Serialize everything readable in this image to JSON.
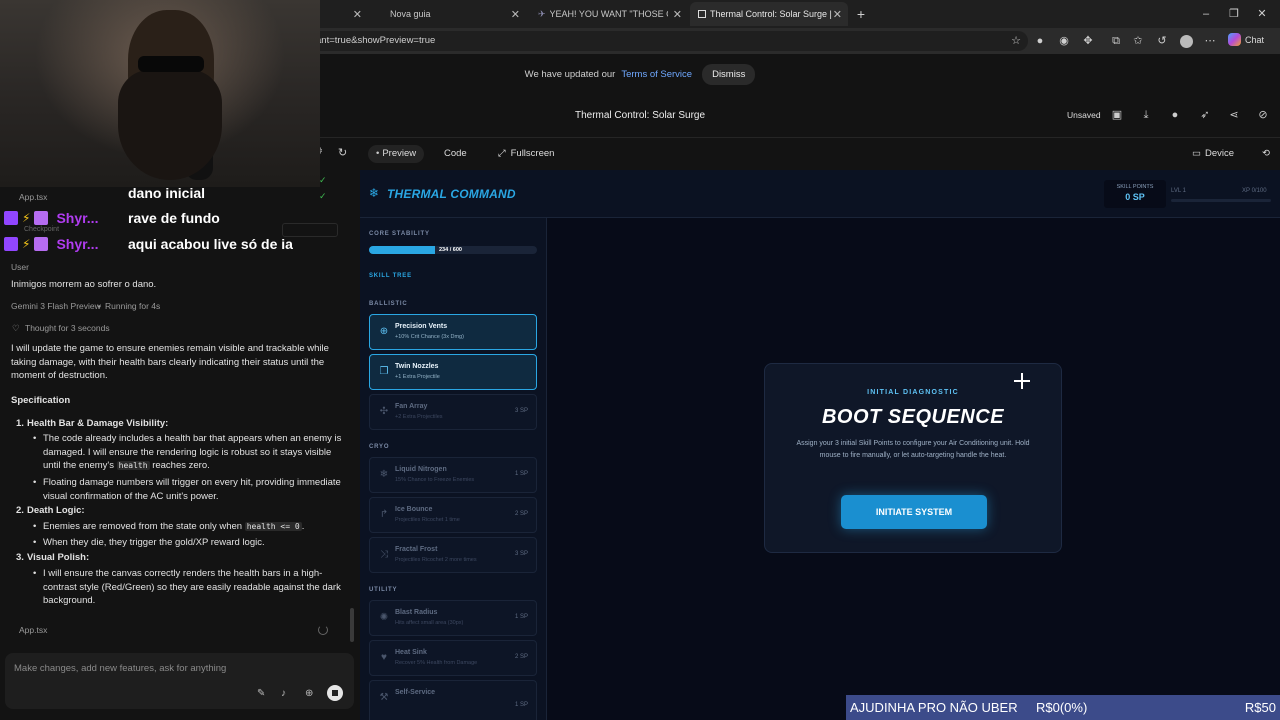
{
  "browser": {
    "tabs": [
      {
        "label": "Nova guia"
      },
      {
        "label": "YEAH! YOU WANT \"THOSE GAMES\"..."
      },
      {
        "label": "Thermal Control: Solar Surge | Go..."
      }
    ],
    "new_tab_label": "+",
    "url": "ant=true&showPreview=true",
    "chat_label": "Chat"
  },
  "notice": {
    "text": "We have updated our",
    "link": "Terms of Service",
    "dismiss": "Dismiss"
  },
  "app": {
    "title": "Thermal Control: Solar Surge",
    "unsaved": "Unsaved"
  },
  "stream_chat": [
    {
      "user": "",
      "msg": "dano inicial"
    },
    {
      "user": "Shyr...",
      "msg": "rave de fundo"
    },
    {
      "user": "Shyr...",
      "msg": "aqui acabou live só de ia"
    }
  ],
  "chat": {
    "file1": "App.tsx",
    "checkpoint": "Checkpoint",
    "user_label": "User",
    "user_msg": "Inimigos morrem ao sofrer o dano.",
    "model": "Gemini 3 Flash Preview",
    "running": "Running for 4s",
    "thought": "Thought for 3 seconds",
    "intro": "I will update the game to ensure enemies remain visible and trackable while taking damage, with their health bars clearly indicating their status until the moment of destruction.",
    "spec_heading": "Specification",
    "items": [
      {
        "num": "1.",
        "title": "Health Bar & Damage Visibility",
        "b1a": "The code already includes a health bar that appears when an enemy is damaged. I will ensure the rendering logic is robust so it stays visible until the enemy's",
        "b1code": "health",
        "b1b": "reaches zero.",
        "b2": "Floating damage numbers will trigger on every hit, providing immediate visual confirmation of the AC unit's power."
      },
      {
        "num": "2.",
        "title": "Death Logic",
        "b1a": "Enemies are removed from the state only when",
        "b1code": "health <= 0",
        "b1b": ".",
        "b2": "When they die, they trigger the gold/XP reward logic."
      },
      {
        "num": "3.",
        "title": "Visual Polish",
        "b1a": "I will ensure the canvas correctly renders the health bars in a high-contrast style (Red/Green) so they are easily readable against the dark background."
      }
    ],
    "file2": "App.tsx",
    "input_placeholder": "Make changes, add new features, ask for anything"
  },
  "preview_bar": {
    "preview": "Preview",
    "code": "Code",
    "fullscreen": "Fullscreen",
    "device": "Device"
  },
  "game": {
    "title": "THERMAL COMMAND",
    "skill_points_label": "SKILL POINTS",
    "skill_points_value": "0 SP",
    "level": "LVL 1",
    "xp": "XP 0/100",
    "core_stability_label": "CORE STABILITY",
    "core_stability_text": "234 / 600",
    "core_stability_fraction": 0.39,
    "skill_tree_label": "SKILL TREE",
    "sections": {
      "ballistic": "BALLISTIC",
      "cryo": "CRYO",
      "utility": "UTILITY"
    },
    "skills": [
      {
        "name": "Precision Vents",
        "desc": "+10% Crit Chance (3x Dmg)",
        "cost": "",
        "icon": "crosshair-icon"
      },
      {
        "name": "Twin Nozzles",
        "desc": "+1 Extra Projectile",
        "cost": "",
        "icon": "copy-icon"
      },
      {
        "name": "Fan Array",
        "desc": "+2 Extra Projectiles",
        "cost": "3 SP",
        "icon": "fan-icon"
      },
      {
        "name": "Liquid Nitrogen",
        "desc": "15% Chance to Freeze Enemies",
        "cost": "1 SP",
        "icon": "snowflake-icon"
      },
      {
        "name": "Ice Bounce",
        "desc": "Projectiles Ricochet 1 time",
        "cost": "2 SP",
        "icon": "bounce-icon"
      },
      {
        "name": "Fractal Frost",
        "desc": "Projectiles Ricochet 2 more times",
        "cost": "3 SP",
        "icon": "fractal-icon"
      },
      {
        "name": "Blast Radius",
        "desc": "Hits affect small area (30px)",
        "cost": "1 SP",
        "icon": "blast-icon"
      },
      {
        "name": "Heat Sink",
        "desc": "Recover 5% Health from Damage",
        "cost": "2 SP",
        "icon": "heart-icon"
      },
      {
        "name": "Self-Service",
        "desc": "",
        "cost": "1 SP",
        "icon": "wrench-icon"
      }
    ],
    "boot": {
      "kicker": "INITIAL DIAGNOSTIC",
      "title": "BOOT SEQUENCE",
      "desc": "Assign your 3 initial Skill Points to configure your Air Conditioning unit. Hold mouse to fire manually, or let auto-targeting handle the heat.",
      "button": "INITIATE SYSTEM"
    }
  },
  "donation": {
    "label": "AJUDINHA PRO NÃO UBER",
    "current": "R$0(0%)",
    "goal": "R$50"
  }
}
